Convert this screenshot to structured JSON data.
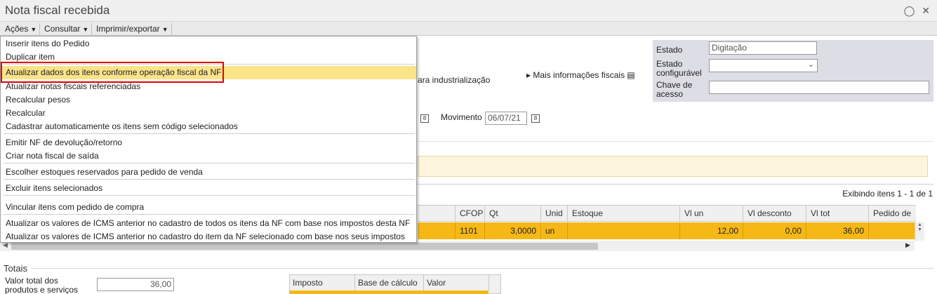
{
  "window": {
    "title": "Nota fiscal recebida"
  },
  "menubar": {
    "acoes": "Ações",
    "consultar": "Consultar",
    "imprimir": "Imprimir/exportar"
  },
  "dropdown": {
    "items": [
      "Inserir itens do Pedido",
      "Duplicar item",
      "Atualizar dados dos itens conforme operação fiscal da NF",
      "Atualizar notas fiscais referenciadas",
      "Recalcular pesos",
      "Recalcular",
      "Cadastrar automaticamente os itens sem código selecionados",
      "Emitir NF de devolução/retorno",
      "Criar nota fiscal de saída",
      "Escolher estoques reservados para pedido de venda",
      "Excluir itens selecionados",
      "Vincular itens com pedido de compra",
      "Atualizar os valores de ICMS anterior no cadastro de todos os itens da NF com base nos impostos desta NF",
      "Atualizar os valores de ICMS anterior no cadastro do item da NF selecionado com base nos seus impostos"
    ]
  },
  "header": {
    "operacao_partial": "ara industrialização",
    "mais_info": "Mais informações fiscais",
    "movimento_label": "Movimento",
    "movimento_value": "06/07/21",
    "estado_label": "Estado",
    "estado_value": "Digitação",
    "estado_config_label_1": "Estado",
    "estado_config_label_2": "configurável",
    "chave_label_1": "Chave de",
    "chave_label_2": "acesso"
  },
  "grid": {
    "count_text": "Exibindo itens 1 - 1 de 1",
    "columns": [
      "CFOP",
      "Qt",
      "Unid",
      "Estoque",
      "Vl un",
      "Vl desconto",
      "Vl tot",
      "Pedido de"
    ],
    "row": {
      "cfop": "1101",
      "qt": "3,0000",
      "unid": "un",
      "estoque": "",
      "vl_un": "12,00",
      "vl_desconto": "0,00",
      "vl_tot": "36,00",
      "pedido": ""
    }
  },
  "totals": {
    "label": "Totais",
    "valor_total_label_1": "Valor total dos",
    "valor_total_label_2": "produtos e serviços",
    "valor_total_value": "36,00",
    "tax_columns": [
      "Imposto",
      "Base de cálculo",
      "Valor"
    ]
  },
  "colors": {
    "highlight_row": "#f5b816",
    "menu_highlight": "#fbe38a",
    "red_box": "#e00000",
    "status_panel": "#dddde6"
  }
}
